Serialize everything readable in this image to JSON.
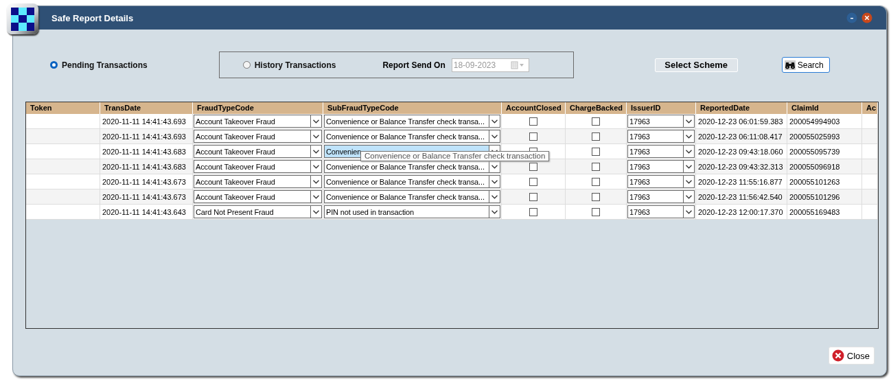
{
  "window": {
    "title": "Safe Report Details"
  },
  "filters": {
    "options": [
      {
        "label": "Pending Transactions",
        "selected": true
      },
      {
        "label": "History Transactions",
        "selected": false
      }
    ],
    "report_send_on": {
      "label": "Report Send On",
      "value": "18-09-2023",
      "disabled": true
    }
  },
  "select_scheme": "Select Scheme",
  "search": "Search",
  "table": {
    "columns": [
      "Token",
      "TransDate",
      "FraudTypeCode",
      "SubFraudTypeCode",
      "AccountClosed",
      "ChargeBacked",
      "IssuerID",
      "ReportedDate",
      "ClaimId",
      "Ac"
    ],
    "rows": [
      {
        "trans_date": "2020-11-11 14:41:43.693",
        "fraud_type": "Account Takeover Fraud",
        "sub_fraud_type": "Convenience or Balance Transfer check transa...",
        "sub_highlighted": false,
        "account_closed": false,
        "charge_backed": false,
        "issuer_id": "17963",
        "reported_date": "2020-12-23 06:01:59.383",
        "claim_id": "200054994903"
      },
      {
        "trans_date": "2020-11-11 14:41:43.693",
        "fraud_type": "Account Takeover Fraud",
        "sub_fraud_type": "Convenience or Balance Transfer check transa...",
        "sub_highlighted": false,
        "account_closed": false,
        "charge_backed": false,
        "issuer_id": "17963",
        "reported_date": "2020-12-23 06:11:08.417",
        "claim_id": "200055025993"
      },
      {
        "trans_date": "2020-11-11 14:41:43.683",
        "fraud_type": "Account Takeover Fraud",
        "sub_fraud_type": "Convenien",
        "sub_highlighted": true,
        "account_closed": false,
        "charge_backed": false,
        "issuer_id": "17963",
        "reported_date": "2020-12-23 09:43:18.060",
        "claim_id": "200055095739"
      },
      {
        "trans_date": "2020-11-11 14:41:43.683",
        "fraud_type": "Account Takeover Fraud",
        "sub_fraud_type": "Convenience or Balance Transfer check transa...",
        "sub_highlighted": false,
        "account_closed": false,
        "charge_backed": false,
        "issuer_id": "17963",
        "reported_date": "2020-12-23 09:43:32.313",
        "claim_id": "200055096918"
      },
      {
        "trans_date": "2020-11-11 14:41:43.673",
        "fraud_type": "Account Takeover Fraud",
        "sub_fraud_type": "Convenience or Balance Transfer check transa...",
        "sub_highlighted": false,
        "account_closed": false,
        "charge_backed": false,
        "issuer_id": "17963",
        "reported_date": "2020-12-23 11:55:16.877",
        "claim_id": "200055101263"
      },
      {
        "trans_date": "2020-11-11 14:41:43.673",
        "fraud_type": "Account Takeover Fraud",
        "sub_fraud_type": "Convenience or Balance Transfer check transa...",
        "sub_highlighted": false,
        "account_closed": false,
        "charge_backed": false,
        "issuer_id": "17963",
        "reported_date": "2020-12-23 11:56:42.540",
        "claim_id": "200055101296"
      },
      {
        "trans_date": "2020-11-11 14:41:43.643",
        "fraud_type": "Card Not Present Fraud",
        "sub_fraud_type": "PIN not used in transaction",
        "sub_highlighted": false,
        "account_closed": false,
        "charge_backed": false,
        "issuer_id": "17963",
        "reported_date": "2020-12-23 12:00:17.370",
        "claim_id": "200055169483"
      }
    ],
    "tooltip": "Convenience or Balance Transfer check transaction"
  },
  "close": "Close"
}
